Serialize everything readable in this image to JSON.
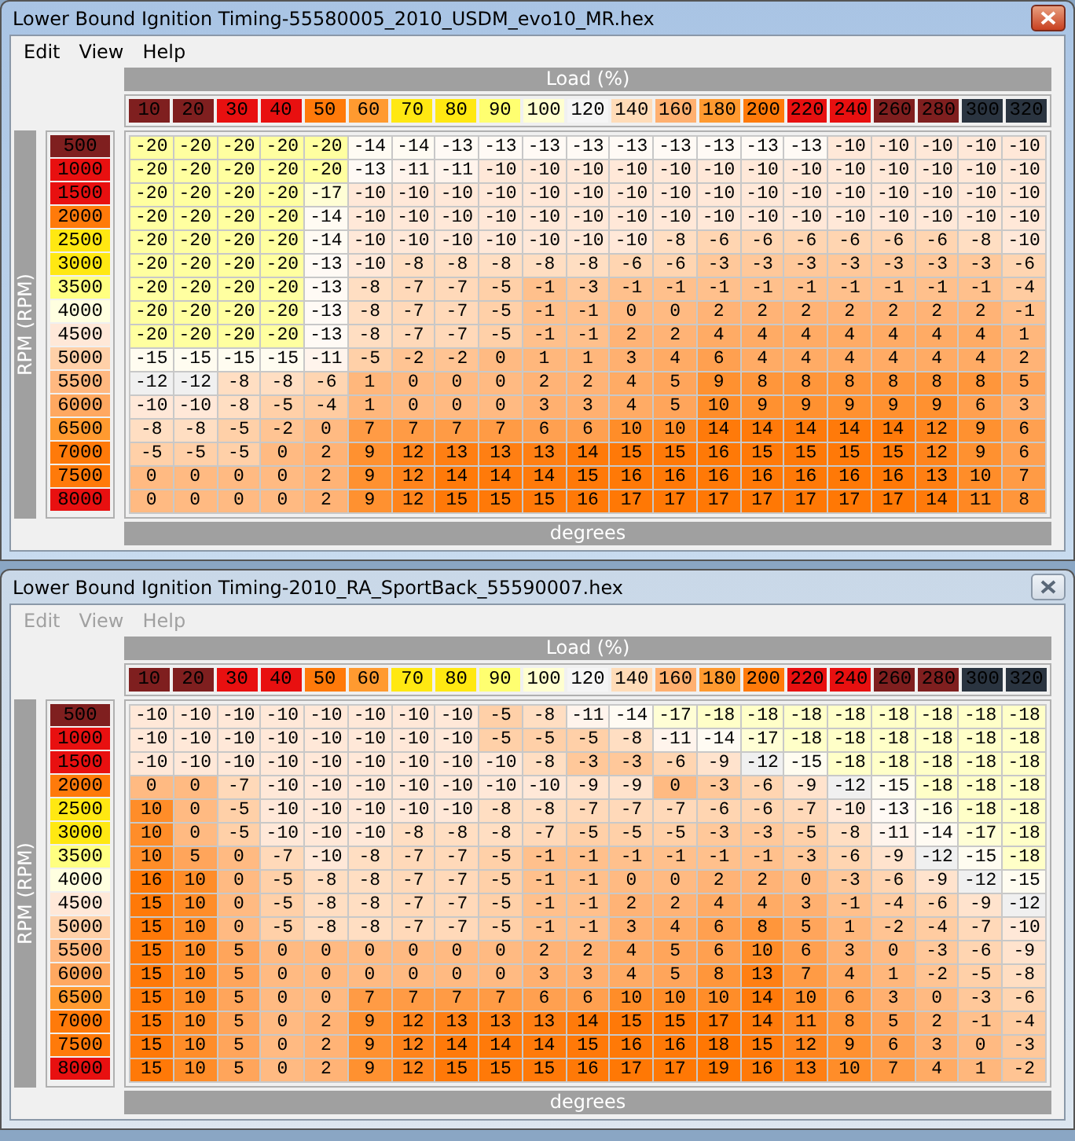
{
  "windows": [
    {
      "title": "Lower Bound Ignition Timing-55580005_2010_USDM_evo10_MR.hex",
      "active": true,
      "menu": [
        {
          "label": "Edit",
          "disabled": false
        },
        {
          "label": "View",
          "disabled": false
        },
        {
          "label": "Help",
          "disabled": false
        }
      ],
      "x_axis_label": "Load (%)",
      "y_axis_label": "RPM (RPM)",
      "unit_label": "degrees",
      "columns": [
        {
          "label": "10",
          "color": "#7f1f1f"
        },
        {
          "label": "20",
          "color": "#7f1f1f"
        },
        {
          "label": "30",
          "color": "#e81010"
        },
        {
          "label": "40",
          "color": "#e81010"
        },
        {
          "label": "50",
          "color": "#ff7a0a"
        },
        {
          "label": "60",
          "color": "#ff9a30"
        },
        {
          "label": "70",
          "color": "#ffe812"
        },
        {
          "label": "80",
          "color": "#ffe812"
        },
        {
          "label": "90",
          "color": "#ffff70"
        },
        {
          "label": "100",
          "color": "#ffffd0"
        },
        {
          "label": "120",
          "color": "#f5f5f5"
        },
        {
          "label": "140",
          "color": "#ffdcb8"
        },
        {
          "label": "160",
          "color": "#ffb070"
        },
        {
          "label": "180",
          "color": "#ff9a30"
        },
        {
          "label": "200",
          "color": "#ff7a0a"
        },
        {
          "label": "220",
          "color": "#e81010"
        },
        {
          "label": "240",
          "color": "#e81010"
        },
        {
          "label": "260",
          "color": "#7f1f1f"
        },
        {
          "label": "280",
          "color": "#7f1f1f"
        },
        {
          "label": "300",
          "color": "#2a3440"
        },
        {
          "label": "320",
          "color": "#2a3440"
        }
      ],
      "rows": [
        {
          "rpm": "500",
          "color": "#7f1f1f",
          "cells": [
            "-20",
            "-20",
            "-20",
            "-20",
            "-20",
            "-14",
            "-14",
            "-13",
            "-13",
            "-13",
            "-13",
            "-13",
            "-13",
            "-13",
            "-13",
            "-13",
            "-10",
            "-10",
            "-10",
            "-10",
            "-10"
          ]
        },
        {
          "rpm": "1000",
          "color": "#e81010",
          "cells": [
            "-20",
            "-20",
            "-20",
            "-20",
            "-20",
            "-13",
            "-11",
            "-11",
            "-10",
            "-10",
            "-10",
            "-10",
            "-10",
            "-10",
            "-10",
            "-10",
            "-10",
            "-10",
            "-10",
            "-10",
            "-10"
          ]
        },
        {
          "rpm": "1500",
          "color": "#e81010",
          "cells": [
            "-20",
            "-20",
            "-20",
            "-20",
            "-17",
            "-10",
            "-10",
            "-10",
            "-10",
            "-10",
            "-10",
            "-10",
            "-10",
            "-10",
            "-10",
            "-10",
            "-10",
            "-10",
            "-10",
            "-10",
            "-10"
          ]
        },
        {
          "rpm": "2000",
          "color": "#ff7a0a",
          "cells": [
            "-20",
            "-20",
            "-20",
            "-20",
            "-14",
            "-10",
            "-10",
            "-10",
            "-10",
            "-10",
            "-10",
            "-10",
            "-10",
            "-10",
            "-10",
            "-10",
            "-10",
            "-10",
            "-10",
            "-10",
            "-10"
          ]
        },
        {
          "rpm": "2500",
          "color": "#ffe812",
          "cells": [
            "-20",
            "-20",
            "-20",
            "-20",
            "-14",
            "-10",
            "-10",
            "-10",
            "-10",
            "-10",
            "-10",
            "-10",
            "-8",
            "-6",
            "-6",
            "-6",
            "-6",
            "-6",
            "-6",
            "-8",
            "-10"
          ]
        },
        {
          "rpm": "3000",
          "color": "#ffe812",
          "cells": [
            "-20",
            "-20",
            "-20",
            "-20",
            "-13",
            "-10",
            "-8",
            "-8",
            "-8",
            "-8",
            "-8",
            "-6",
            "-6",
            "-3",
            "-3",
            "-3",
            "-3",
            "-3",
            "-3",
            "-3",
            "-6"
          ]
        },
        {
          "rpm": "3500",
          "color": "#ffff80",
          "cells": [
            "-20",
            "-20",
            "-20",
            "-20",
            "-13",
            "-8",
            "-7",
            "-7",
            "-5",
            "-1",
            "-3",
            "-1",
            "-1",
            "-1",
            "-1",
            "-1",
            "-1",
            "-1",
            "-1",
            "-1",
            "-4"
          ]
        },
        {
          "rpm": "4000",
          "color": "#ffffe0",
          "cells": [
            "-20",
            "-20",
            "-20",
            "-20",
            "-13",
            "-8",
            "-7",
            "-7",
            "-5",
            "-1",
            "-1",
            "0",
            "0",
            "2",
            "2",
            "2",
            "2",
            "2",
            "2",
            "2",
            "-1"
          ]
        },
        {
          "rpm": "4500",
          "color": "#ffe8d8",
          "cells": [
            "-20",
            "-20",
            "-20",
            "-20",
            "-13",
            "-8",
            "-7",
            "-7",
            "-5",
            "-1",
            "-1",
            "2",
            "2",
            "4",
            "4",
            "4",
            "4",
            "4",
            "4",
            "4",
            "1"
          ]
        },
        {
          "rpm": "5000",
          "color": "#ffd0a8",
          "cells": [
            "-15",
            "-15",
            "-15",
            "-15",
            "-11",
            "-5",
            "-2",
            "-2",
            "0",
            "1",
            "1",
            "3",
            "4",
            "6",
            "4",
            "4",
            "4",
            "4",
            "4",
            "4",
            "2"
          ]
        },
        {
          "rpm": "5500",
          "color": "#ffb880",
          "cells": [
            "-12",
            "-12",
            "-8",
            "-8",
            "-6",
            "1",
            "0",
            "0",
            "0",
            "2",
            "2",
            "4",
            "5",
            "9",
            "8",
            "8",
            "8",
            "8",
            "8",
            "8",
            "5"
          ]
        },
        {
          "rpm": "6000",
          "color": "#ffa860",
          "cells": [
            "-10",
            "-10",
            "-8",
            "-5",
            "-4",
            "1",
            "0",
            "0",
            "0",
            "3",
            "3",
            "4",
            "5",
            "10",
            "9",
            "9",
            "9",
            "9",
            "9",
            "6",
            "3"
          ]
        },
        {
          "rpm": "6500",
          "color": "#ff9a30",
          "cells": [
            "-8",
            "-8",
            "-5",
            "-2",
            "0",
            "7",
            "7",
            "7",
            "7",
            "6",
            "6",
            "10",
            "10",
            "14",
            "14",
            "14",
            "14",
            "14",
            "12",
            "9",
            "6"
          ]
        },
        {
          "rpm": "7000",
          "color": "#ff7a0a",
          "cells": [
            "-5",
            "-5",
            "-5",
            "0",
            "2",
            "9",
            "12",
            "13",
            "13",
            "13",
            "14",
            "15",
            "15",
            "16",
            "15",
            "15",
            "15",
            "15",
            "12",
            "9",
            "6"
          ]
        },
        {
          "rpm": "7500",
          "color": "#ff7a0a",
          "cells": [
            "0",
            "0",
            "0",
            "0",
            "2",
            "9",
            "12",
            "14",
            "14",
            "14",
            "15",
            "16",
            "16",
            "16",
            "16",
            "16",
            "16",
            "16",
            "13",
            "10",
            "7"
          ]
        },
        {
          "rpm": "8000",
          "color": "#e81010",
          "cells": [
            "0",
            "0",
            "0",
            "0",
            "2",
            "9",
            "12",
            "15",
            "15",
            "15",
            "16",
            "17",
            "17",
            "17",
            "17",
            "17",
            "17",
            "17",
            "14",
            "11",
            "8"
          ]
        }
      ]
    },
    {
      "title": "Lower Bound Ignition Timing-2010_RA_SportBack_55590007.hex",
      "active": false,
      "menu": [
        {
          "label": "Edit",
          "disabled": true
        },
        {
          "label": "View",
          "disabled": true
        },
        {
          "label": "Help",
          "disabled": true
        }
      ],
      "x_axis_label": "Load (%)",
      "y_axis_label": "RPM (RPM)",
      "unit_label": "degrees",
      "columns": [
        {
          "label": "10",
          "color": "#7f1f1f"
        },
        {
          "label": "20",
          "color": "#7f1f1f"
        },
        {
          "label": "30",
          "color": "#e81010"
        },
        {
          "label": "40",
          "color": "#e81010"
        },
        {
          "label": "50",
          "color": "#ff7a0a"
        },
        {
          "label": "60",
          "color": "#ff9a30"
        },
        {
          "label": "70",
          "color": "#ffe812"
        },
        {
          "label": "80",
          "color": "#ffe812"
        },
        {
          "label": "90",
          "color": "#ffff70"
        },
        {
          "label": "100",
          "color": "#ffffd0"
        },
        {
          "label": "120",
          "color": "#f5f5f5"
        },
        {
          "label": "140",
          "color": "#ffdcb8"
        },
        {
          "label": "160",
          "color": "#ffb070"
        },
        {
          "label": "180",
          "color": "#ff9a30"
        },
        {
          "label": "200",
          "color": "#ff7a0a"
        },
        {
          "label": "220",
          "color": "#e81010"
        },
        {
          "label": "240",
          "color": "#e81010"
        },
        {
          "label": "260",
          "color": "#7f1f1f"
        },
        {
          "label": "280",
          "color": "#7f1f1f"
        },
        {
          "label": "300",
          "color": "#2a3440"
        },
        {
          "label": "320",
          "color": "#2a3440"
        }
      ],
      "rows": [
        {
          "rpm": "500",
          "color": "#7f1f1f",
          "cells": [
            "-10",
            "-10",
            "-10",
            "-10",
            "-10",
            "-10",
            "-10",
            "-10",
            "-5",
            "-8",
            "-11",
            "-14",
            "-17",
            "-18",
            "-18",
            "-18",
            "-18",
            "-18",
            "-18",
            "-18",
            "-18"
          ]
        },
        {
          "rpm": "1000",
          "color": "#e81010",
          "cells": [
            "-10",
            "-10",
            "-10",
            "-10",
            "-10",
            "-10",
            "-10",
            "-10",
            "-5",
            "-5",
            "-5",
            "-8",
            "-11",
            "-14",
            "-17",
            "-18",
            "-18",
            "-18",
            "-18",
            "-18",
            "-18"
          ]
        },
        {
          "rpm": "1500",
          "color": "#e81010",
          "cells": [
            "-10",
            "-10",
            "-10",
            "-10",
            "-10",
            "-10",
            "-10",
            "-10",
            "-10",
            "-8",
            "-3",
            "-3",
            "-6",
            "-9",
            "-12",
            "-15",
            "-18",
            "-18",
            "-18",
            "-18",
            "-18"
          ]
        },
        {
          "rpm": "2000",
          "color": "#ff7a0a",
          "cells": [
            "0",
            "0",
            "-7",
            "-10",
            "-10",
            "-10",
            "-10",
            "-10",
            "-10",
            "-10",
            "-9",
            "-9",
            "0",
            "-3",
            "-6",
            "-9",
            "-12",
            "-15",
            "-18",
            "-18",
            "-18"
          ]
        },
        {
          "rpm": "2500",
          "color": "#ffe812",
          "cells": [
            "10",
            "0",
            "-5",
            "-10",
            "-10",
            "-10",
            "-10",
            "-10",
            "-8",
            "-8",
            "-7",
            "-7",
            "-7",
            "-6",
            "-6",
            "-7",
            "-10",
            "-13",
            "-16",
            "-18",
            "-18"
          ]
        },
        {
          "rpm": "3000",
          "color": "#ffe812",
          "cells": [
            "10",
            "0",
            "-5",
            "-10",
            "-10",
            "-10",
            "-8",
            "-8",
            "-8",
            "-7",
            "-5",
            "-5",
            "-5",
            "-3",
            "-3",
            "-5",
            "-8",
            "-11",
            "-14",
            "-17",
            "-18"
          ]
        },
        {
          "rpm": "3500",
          "color": "#ffff80",
          "cells": [
            "10",
            "5",
            "0",
            "-7",
            "-10",
            "-8",
            "-7",
            "-7",
            "-5",
            "-1",
            "-1",
            "-1",
            "-1",
            "-1",
            "-1",
            "-3",
            "-6",
            "-9",
            "-12",
            "-15",
            "-18"
          ]
        },
        {
          "rpm": "4000",
          "color": "#ffffe0",
          "cells": [
            "16",
            "10",
            "0",
            "-5",
            "-8",
            "-8",
            "-7",
            "-7",
            "-5",
            "-1",
            "-1",
            "0",
            "0",
            "2",
            "2",
            "0",
            "-3",
            "-6",
            "-9",
            "-12",
            "-15"
          ]
        },
        {
          "rpm": "4500",
          "color": "#ffe8d8",
          "cells": [
            "15",
            "10",
            "0",
            "-5",
            "-8",
            "-8",
            "-7",
            "-7",
            "-5",
            "-1",
            "-1",
            "2",
            "2",
            "4",
            "4",
            "3",
            "-1",
            "-4",
            "-6",
            "-9",
            "-12"
          ]
        },
        {
          "rpm": "5000",
          "color": "#ffd0a8",
          "cells": [
            "15",
            "10",
            "0",
            "-5",
            "-8",
            "-8",
            "-7",
            "-7",
            "-5",
            "-1",
            "-1",
            "3",
            "4",
            "6",
            "8",
            "5",
            "1",
            "-2",
            "-4",
            "-7",
            "-10"
          ]
        },
        {
          "rpm": "5500",
          "color": "#ffb880",
          "cells": [
            "15",
            "10",
            "5",
            "0",
            "0",
            "0",
            "0",
            "0",
            "0",
            "2",
            "2",
            "4",
            "5",
            "6",
            "10",
            "6",
            "3",
            "0",
            "-3",
            "-6",
            "-9"
          ]
        },
        {
          "rpm": "6000",
          "color": "#ffa860",
          "cells": [
            "15",
            "10",
            "5",
            "0",
            "0",
            "0",
            "0",
            "0",
            "0",
            "3",
            "3",
            "4",
            "5",
            "8",
            "13",
            "7",
            "4",
            "1",
            "-2",
            "-5",
            "-8"
          ]
        },
        {
          "rpm": "6500",
          "color": "#ff9a30",
          "cells": [
            "15",
            "10",
            "5",
            "0",
            "0",
            "7",
            "7",
            "7",
            "7",
            "6",
            "6",
            "10",
            "10",
            "10",
            "14",
            "10",
            "6",
            "3",
            "0",
            "-3",
            "-6"
          ]
        },
        {
          "rpm": "7000",
          "color": "#ff7a0a",
          "cells": [
            "15",
            "10",
            "5",
            "0",
            "2",
            "9",
            "12",
            "13",
            "13",
            "13",
            "14",
            "15",
            "15",
            "17",
            "14",
            "11",
            "8",
            "5",
            "2",
            "-1",
            "-4"
          ]
        },
        {
          "rpm": "7500",
          "color": "#ff7a0a",
          "cells": [
            "15",
            "10",
            "5",
            "0",
            "2",
            "9",
            "12",
            "14",
            "14",
            "14",
            "15",
            "16",
            "16",
            "18",
            "15",
            "12",
            "9",
            "6",
            "3",
            "0",
            "-3"
          ]
        },
        {
          "rpm": "8000",
          "color": "#e81010",
          "cells": [
            "15",
            "10",
            "5",
            "0",
            "2",
            "9",
            "12",
            "15",
            "15",
            "15",
            "16",
            "17",
            "17",
            "19",
            "16",
            "13",
            "10",
            "7",
            "4",
            "1",
            "-2"
          ]
        }
      ]
    }
  ]
}
